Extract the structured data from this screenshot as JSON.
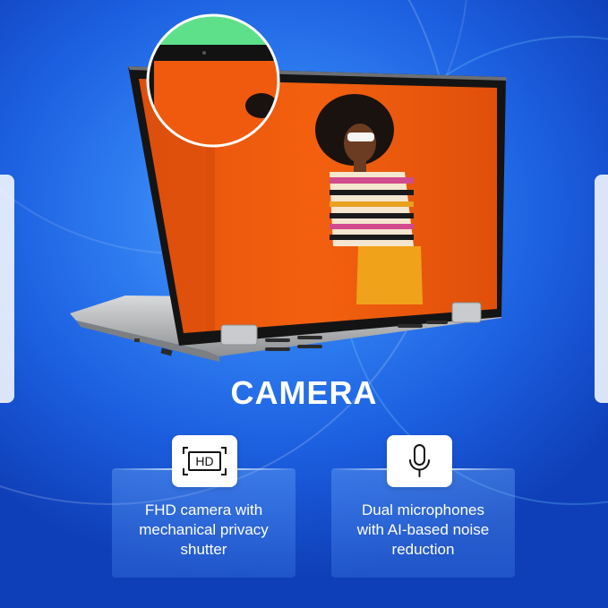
{
  "headline": "CAMERA",
  "features": [
    {
      "icon": "hd-camera-icon",
      "line1": "FHD camera with",
      "line2": "mechanical privacy",
      "line3": "shutter"
    },
    {
      "icon": "microphone-icon",
      "line1": "Dual microphones",
      "line2": "with AI-based noise",
      "line3": "reduction"
    }
  ],
  "hd_badge": "HD",
  "colors": {
    "background": "#1c5fe0",
    "screen_wall": "#f0590e",
    "zoom_bezel_green": "#5ee08a"
  }
}
